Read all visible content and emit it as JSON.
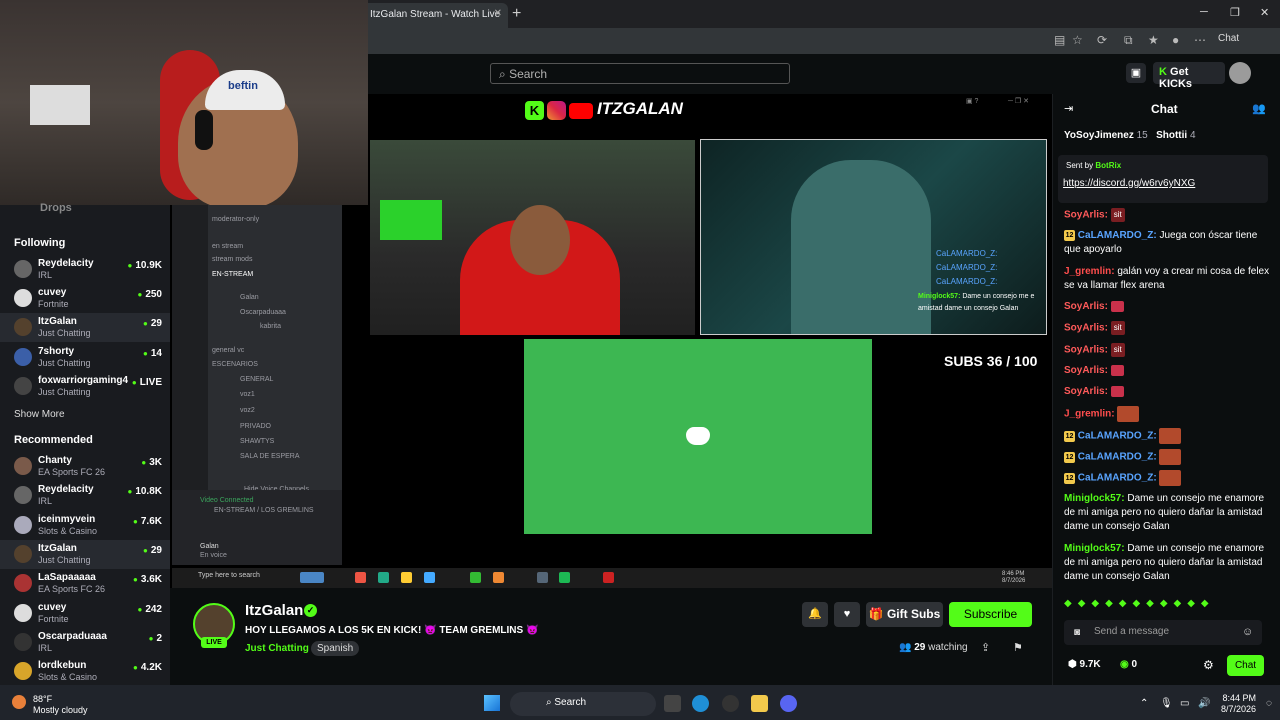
{
  "browser": {
    "tab_title": "ItzGalan Stream - Watch Live",
    "new_tab": "+",
    "win_min": "─",
    "win_max": "❐",
    "win_close": "✕",
    "copilot_chat": "Chat"
  },
  "header": {
    "search_placeholder": "Search",
    "get_kicks": "Get KICKs",
    "get_kicks_icon": "K"
  },
  "webcam": {
    "hat_logo": "beftin"
  },
  "sidebar": {
    "drops": "Drops",
    "following_title": "Following",
    "following": [
      {
        "name": "Reydelacity",
        "category": "IRL",
        "count": "10.9K"
      },
      {
        "name": "cuvey",
        "category": "Fortnite",
        "count": "250"
      },
      {
        "name": "ItzGalan",
        "category": "Just Chatting",
        "count": "29"
      },
      {
        "name": "7shorty",
        "category": "Just Chatting",
        "count": "14"
      },
      {
        "name": "foxwarriorgaming4",
        "category": "Just Chatting",
        "count": "LIVE"
      }
    ],
    "show_more": "Show More",
    "recommended_title": "Recommended",
    "recommended": [
      {
        "name": "Chanty",
        "category": "EA Sports FC 26",
        "count": "3K"
      },
      {
        "name": "Reydelacity",
        "category": "IRL",
        "count": "10.8K"
      },
      {
        "name": "iceinmyvein",
        "category": "Slots & Casino",
        "count": "7.6K"
      },
      {
        "name": "ItzGalan",
        "category": "Just Chatting",
        "count": "29"
      },
      {
        "name": "LaSapaaaaa",
        "category": "EA Sports FC 26",
        "count": "3.6K"
      },
      {
        "name": "cuvey",
        "category": "Fortnite",
        "count": "242"
      },
      {
        "name": "Oscarpaduaaa",
        "category": "IRL",
        "count": "2"
      },
      {
        "name": "lordkebun",
        "category": "Slots & Casino",
        "count": "4.2K"
      }
    ]
  },
  "stream": {
    "logo_k": "K",
    "logo_text": "ITZGALAN",
    "subs_text": "SUBS 36 / 100",
    "discord": {
      "rows": [
        "moderator-only",
        "en stream",
        "stream mods",
        "EN-STREAM",
        "Galan",
        "Oscarpaduaaa",
        "kabrita",
        "general vc",
        "ESCENARIOS",
        "GENERAL",
        "voz1",
        "voz2",
        "PRIVADO",
        "SHAWTYS",
        "SALA DE ESPERA",
        "Hide Voice Channels"
      ],
      "connected": "Video Connected",
      "connected_sub": "EN-STREAM / LOS GREMLINS",
      "user": "Galan",
      "user_sub": "En voice"
    },
    "overlay_names": [
      "CaLAMARDO_Z:",
      "CaLAMARDO_Z:",
      "CaLAMARDO_Z:"
    ],
    "overlay_user": "Miniglock57:",
    "overlay_msg": "Dame un consejo me e",
    "overlay_msg2": "amistad dame un consejo Galan",
    "inner_search": "Type here to search",
    "inner_time": "8:46 PM",
    "inner_date": "8/7/2026"
  },
  "channel": {
    "live": "LIVE",
    "name": "ItzGalan",
    "title": "HOY LLEGAMOS A LOS 5K EN KICK! 👿 TEAM GREMLINS 👿",
    "category": "Just Chatting",
    "language": "Spanish",
    "gift_subs": "Gift Subs",
    "subscribe": "Subscribe",
    "watching_count": "29",
    "watching_label": "watching",
    "icons": {
      "notify": "bell-icon",
      "follow": "heart-icon",
      "share": "share-icon",
      "report": "flag-icon"
    }
  },
  "chat": {
    "title": "Chat",
    "gifters": [
      {
        "name": "YoSoyJimenez",
        "count": "15"
      },
      {
        "name": "Shottii",
        "count": "4"
      }
    ],
    "pinned_sent_by": "Sent by",
    "pinned_bot": "BotRix",
    "pinned_link": "https://discord.gg/w6rv6yNXG",
    "messages": [
      {
        "user": "SoyArlis:",
        "color": "red",
        "text": "",
        "emote": "sit"
      },
      {
        "user": "CaLAMARDO_Z:",
        "color": "blue",
        "badge": "12",
        "text": "Juega con óscar tiene que apoyarlo"
      },
      {
        "user": "J_gremlin:",
        "color": "pink",
        "text": "galán voy a crear mi cosa de felex se va llamar flex arena"
      },
      {
        "user": "SoyArlis:",
        "color": "red",
        "text": ""
      },
      {
        "user": "SoyArlis:",
        "color": "red",
        "text": "",
        "emote": "sit"
      },
      {
        "user": "SoyArlis:",
        "color": "red",
        "text": "",
        "emote": "sit"
      },
      {
        "user": "SoyArlis:",
        "color": "red",
        "text": ""
      },
      {
        "user": "SoyArlis:",
        "color": "red",
        "text": ""
      },
      {
        "user": "J_gremlin:",
        "color": "pink",
        "text": ""
      },
      {
        "user": "CaLAMARDO_Z:",
        "color": "blue",
        "badge": "12",
        "text": ""
      },
      {
        "user": "CaLAMARDO_Z:",
        "color": "blue",
        "badge": "12",
        "text": ""
      },
      {
        "user": "CaLAMARDO_Z:",
        "color": "blue",
        "badge": "12",
        "text": ""
      },
      {
        "user": "Miniglock57:",
        "color": "green",
        "text": "Dame un consejo me enamore de mi amiga pero no quiero dañar la amistad dame un consejo Galan"
      },
      {
        "user": "Miniglock57:",
        "color": "green",
        "text": "Dame un consejo me enamore de mi amiga pero no quiero dañar la amistad dame un consejo Galan"
      }
    ],
    "send_placeholder": "Send a message",
    "points": "9.7K",
    "kicks": "0",
    "chat_button": "Chat"
  },
  "taskbar": {
    "temp": "88°F",
    "weather": "Mostly cloudy",
    "search": "Search",
    "time": "8:44 PM",
    "date": "8/7/2026"
  }
}
